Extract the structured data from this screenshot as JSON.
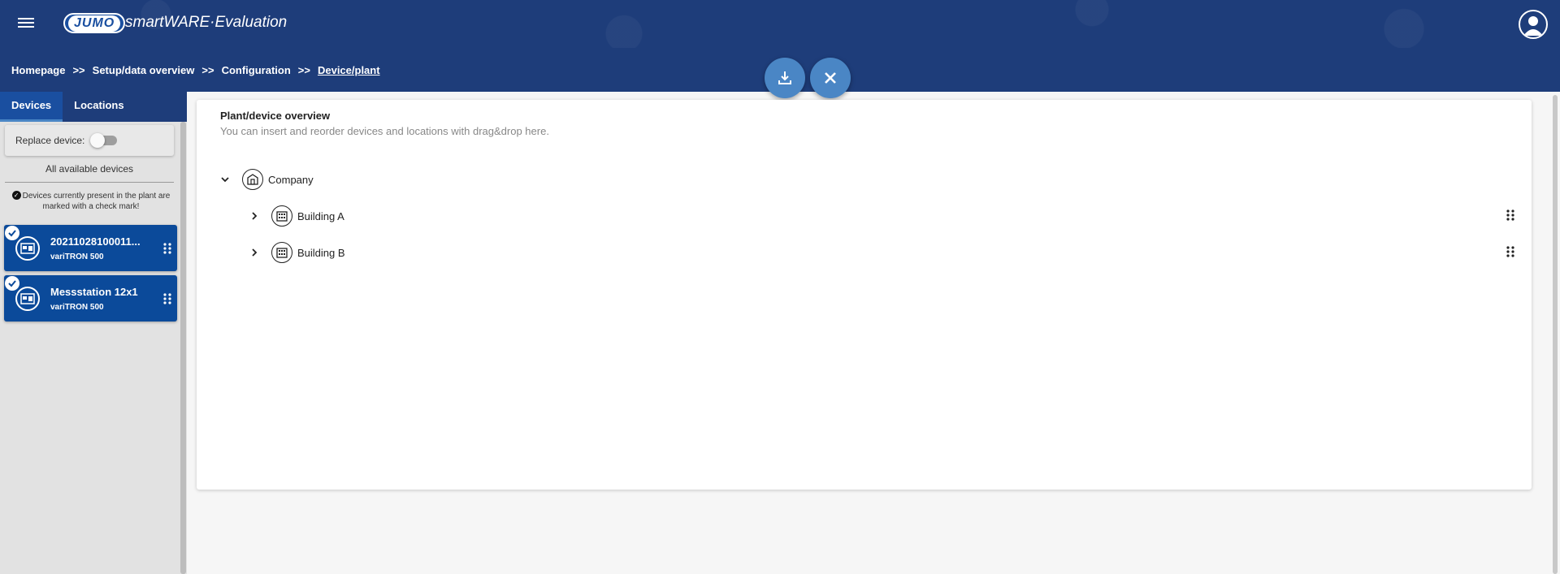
{
  "header": {
    "logo_text": "JUMO",
    "app_title": "smartWARE·Evaluation"
  },
  "breadcrumb": {
    "items": [
      "Homepage",
      "Setup/data overview",
      "Configuration",
      "Device/plant"
    ],
    "separator": ">>"
  },
  "sidebar": {
    "tabs": [
      "Devices",
      "Locations"
    ],
    "replace_label": "Replace device:",
    "all_devices_label": "All available devices",
    "hint": "Devices currently present in the plant are marked with a check mark!",
    "devices": [
      {
        "name": "20211028100011...",
        "type": "variTRON 500"
      },
      {
        "name": "Messstation 12x1",
        "type": "variTRON 500"
      }
    ]
  },
  "main": {
    "title": "Plant/device overview",
    "subtitle": "You can insert and reorder devices and locations with drag&drop here.",
    "tree": {
      "root": "Company",
      "children": [
        "Building A",
        "Building B"
      ]
    }
  },
  "colors": {
    "header_bg": "#1e3d7a",
    "card_bg": "#0b4a9a",
    "fab_bg": "#4a86c5"
  }
}
